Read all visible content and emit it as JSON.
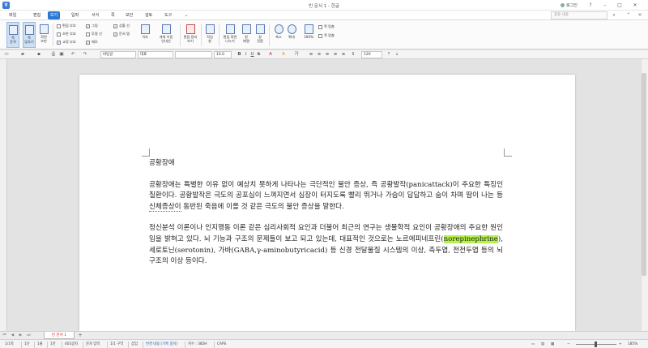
{
  "title_bar": {
    "app_logo_text": "ㅎ",
    "doc_title": "빈 문서 1 - 한글",
    "login_label": "로그인",
    "help_glyph": "?",
    "minimize_glyph": "–",
    "maximize_glyph": "□",
    "close_glyph": "✕"
  },
  "menu": {
    "file": "파일",
    "items": [
      "편집",
      "보기",
      "입력",
      "서식",
      "쪽",
      "보안",
      "검토",
      "도구"
    ],
    "active_index": 1,
    "search_placeholder": "찾을 내용"
  },
  "ribbon": {
    "view_modes": [
      {
        "label": "쪽\n윤곽",
        "selected": true
      },
      {
        "label": "폭\n맞추기",
        "selected": true
      },
      {
        "label": "화면\n조판",
        "selected": false
      }
    ],
    "checks_col1": [
      {
        "label": "편집 부호",
        "checked": false
      },
      {
        "label": "조판 부호",
        "checked": false
      },
      {
        "label": "교정 부호",
        "checked": true
      }
    ],
    "checks_col2": [
      {
        "label": "그림",
        "checked": true
      },
      {
        "label": "투명 선",
        "checked": false
      },
      {
        "label": "메모",
        "checked": true
      }
    ],
    "checks_col3": [
      {
        "label": "상황 선",
        "checked": true
      },
      {
        "label": "문서 탭",
        "checked": true
      }
    ],
    "buttons": [
      {
        "label": "격자"
      },
      {
        "label": "개체 이동\n안내선"
      },
      {
        "label": "편집 용지\n보기"
      },
      {
        "label": "작업\n창"
      },
      {
        "label": "편집 화면\n나누기"
      },
      {
        "label": "창\n배열"
      },
      {
        "label": "창\n전환"
      },
      {
        "label": "축소"
      },
      {
        "label": "확대"
      },
      {
        "label": "100%"
      }
    ],
    "fit_options": [
      "쪽 맞춤",
      "폭 맞춤"
    ]
  },
  "toolbar": {
    "style_combo": "바탕글",
    "font_combo": "대표",
    "size_combo": "10.0",
    "zoom_combo": "120"
  },
  "document": {
    "title": "공황장애",
    "paragraph1_a": "공황장애는 특별한 이유 없이 예상치 못하게 나타나는 극단적인 불안 증상, 즉 공황발작(panicattack)이 주요한 특징인 질환이다. 공황발작은 극도의 공포심이 느껴지면서 심장이 터지도록 빨리 뛰거나 가슴이 답답하고 숨이 차며 땀이 나는 등 ",
    "paragraph1_err": "신체증상이",
    "paragraph1_b": " 동반된 죽음에 이를 것 같은 극도의 불안 증상을 말한다.",
    "paragraph2_a": "정신분석 이론이나 인지행동 이론 같은 심리사회적 요인과 더불어 최근의 연구는 생물학적 요인이 공황장애의 주요한 원인임을 밝혀고 있다. 뇌 기능과 구조의 문제들이 보고 되고 있는데, 대표적인 것으로는 노르에피네프린(",
    "paragraph2_hl": "norepinephrine",
    "paragraph2_b": "), 세로토닌(serotonin), 가바(GABA,γ-aminobutyricacid) 등 신경 전달물질 시스템의 이상, 측두엽, 전전두엽 등의 뇌 구조의 이상 등이다."
  },
  "tabs": {
    "doc_tab": "빈 문서 1",
    "add_tab": "+"
  },
  "status": {
    "page": "1/1쪽",
    "section": "1단",
    "line": "1줄",
    "col": "1칸",
    "chars": "403글자",
    "input_mode": "문자 입력",
    "area": "1/1 구역",
    "insert": "삽입",
    "track": "변경 내용 [기록 중지]",
    "dpi": "저수 : 385H",
    "caps": "CAPS",
    "zoom": "185%"
  }
}
